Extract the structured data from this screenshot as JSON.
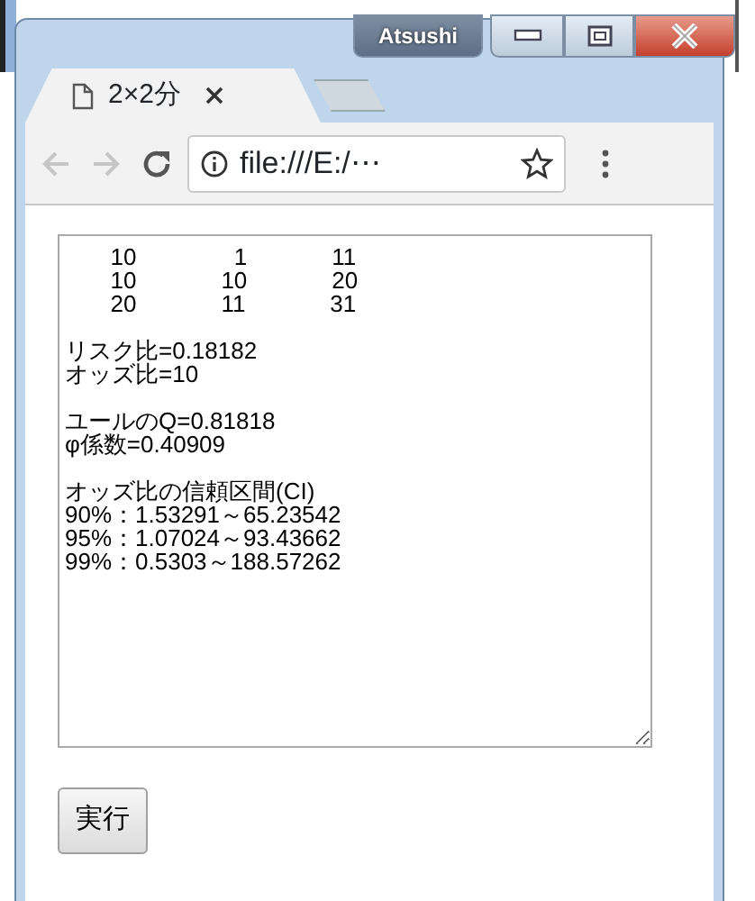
{
  "window": {
    "user": "Atsushi"
  },
  "tabs": [
    {
      "title": "2×2分",
      "selected": true
    }
  ],
  "toolbar": {
    "back_disabled": true,
    "forward_disabled": true,
    "address": "file:///E:/⋯"
  },
  "output": {
    "table": [
      [
        "10",
        "1",
        "11"
      ],
      [
        "10",
        "10",
        "20"
      ],
      [
        "20",
        "11",
        "31"
      ]
    ],
    "blocks": [
      [
        "リスク比=0.18182",
        "オッズ比=10"
      ],
      [
        "ユールのQ=0.81818",
        "φ係数=0.40909"
      ],
      [
        "オッズ比の信頼区間(CI)",
        "90%：1.53291～65.23542",
        "95%：1.07024～93.43662",
        "99%：0.5303～188.57262"
      ]
    ]
  },
  "run_button": "実行"
}
